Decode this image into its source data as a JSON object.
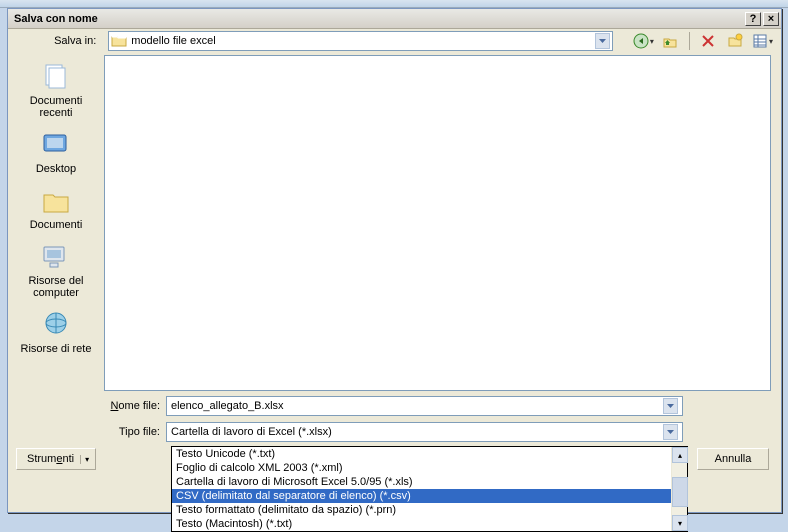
{
  "dialog": {
    "title": "Salva con nome",
    "help_label": "?",
    "close_label": "×"
  },
  "toolbar": {
    "save_in_label": "Salva in:",
    "save_in_value": "modello file excel"
  },
  "places": [
    {
      "label": "Documenti recenti"
    },
    {
      "label": "Desktop"
    },
    {
      "label": "Documenti"
    },
    {
      "label": "Risorse del computer"
    },
    {
      "label": "Risorse di rete"
    }
  ],
  "fields": {
    "filename_label": "Nome file:",
    "filename_value": "elenco_allegato_B.xlsx",
    "filetype_label": "Tipo file:",
    "filetype_value": "Cartella di lavoro di Excel (*.xlsx)"
  },
  "filetype_options": [
    {
      "label": "Testo Unicode (*.txt)",
      "selected": false
    },
    {
      "label": "Foglio di calcolo XML 2003 (*.xml)",
      "selected": false
    },
    {
      "label": "Cartella di lavoro di Microsoft Excel 5.0/95 (*.xls)",
      "selected": false
    },
    {
      "label": "CSV (delimitato dal separatore di elenco) (*.csv)",
      "selected": true
    },
    {
      "label": "Testo formattato (delimitato da spazio) (*.prn)",
      "selected": false
    },
    {
      "label": "Testo (Macintosh) (*.txt)",
      "selected": false
    }
  ],
  "buttons": {
    "tools": "Strumenti",
    "cancel": "Annulla"
  }
}
